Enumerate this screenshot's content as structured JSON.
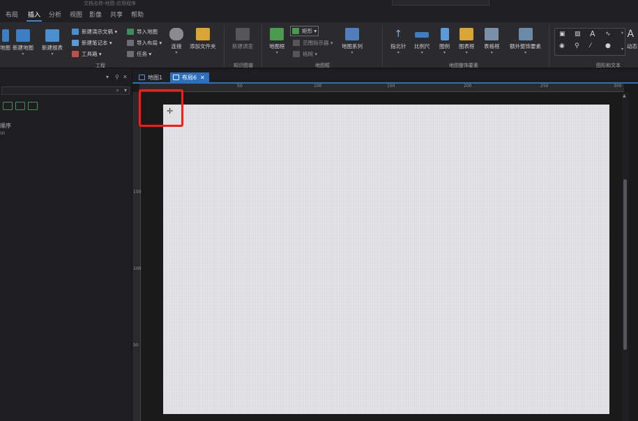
{
  "window": {
    "title": "文档名称-地图-应用程序"
  },
  "menu": [
    "布局",
    "插入",
    "分析",
    "视图",
    "影像",
    "共享",
    "帮助"
  ],
  "ribbon": {
    "left_partial_1": "地图",
    "btn_new_map": "新建地图",
    "btn_new_report": "新建报表",
    "sm_new_presentation": "新建演示文稿",
    "sm_new_notebook": "新建笔记本",
    "sm_toolbox": "工具箱",
    "sm_import_map": "导入地图",
    "sm_import_layout": "导入布局",
    "sm_task": "任务",
    "btn_connect": "连接",
    "btn_add_folder": "添加文件夹",
    "group_project": "工程",
    "btn_new_investigation": "新建调查",
    "group_knowledge": "知识图谱",
    "btn_map_frame": "地图框",
    "sm_rectangle": "矩形",
    "sm_extent_indicator": "范围指示器",
    "sm_grid": "格网",
    "btn_map_series": "地图系列",
    "group_map_frame": "地图框",
    "btn_north_arrow": "指北针",
    "btn_scale_bar": "比例尺",
    "btn_legend": "图例",
    "btn_chart_frame": "图表框",
    "btn_table_frame": "表格框",
    "btn_extra_surround": "额外整饰要素",
    "group_surround": "地图整饰要素",
    "group_graphics_text": "图形和文本",
    "btn_dynamic_partial": "动态"
  },
  "leftpane": {
    "text_order": "顺序",
    "text_sub": "Wi"
  },
  "tabs": [
    {
      "label": "地图1",
      "active": false
    },
    {
      "label": "布局6",
      "active": true
    }
  ],
  "ruler": {
    "h_labels": [
      "50",
      "100",
      "150",
      "200",
      "250",
      "300"
    ],
    "v_labels": [
      "150",
      "100",
      "50"
    ]
  },
  "colors": {
    "accent": "#2c6fbf",
    "highlight": "#ff1a1a",
    "page": "#e3e3e5"
  }
}
